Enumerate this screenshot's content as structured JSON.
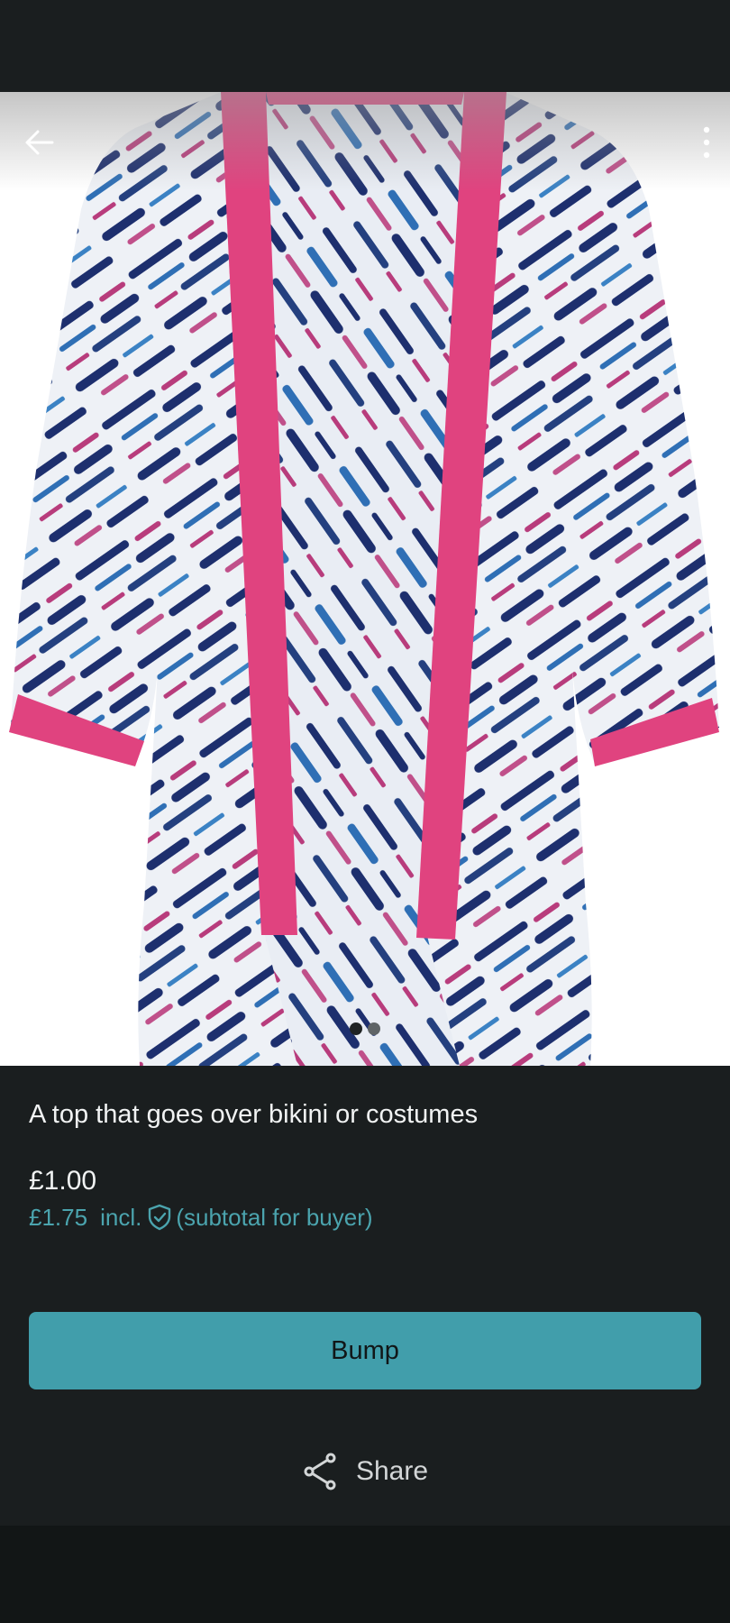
{
  "product": {
    "title": "A top that goes over bikini or costumes",
    "price": "£1.00",
    "buyer_price": "£1.75",
    "buyer_price_incl": "incl.",
    "buyer_price_note": "(subtotal for buyer)",
    "image_count": 2,
    "active_image": 1
  },
  "actions": {
    "bump_label": "Bump",
    "share_label": "Share"
  },
  "icons": {
    "back": "arrow-left-icon",
    "more": "more-vertical-icon",
    "shield": "shield-check-icon",
    "share": "share-icon"
  },
  "colors": {
    "background": "#1a1e1f",
    "accent": "#419eab",
    "accent_text": "#4ba4ae",
    "garment_trim": "#e0437f",
    "garment_dye_navy": "#1d2f6e",
    "garment_dye_blue": "#2f6fb5",
    "garment_dye_pink": "#b83c7c"
  }
}
